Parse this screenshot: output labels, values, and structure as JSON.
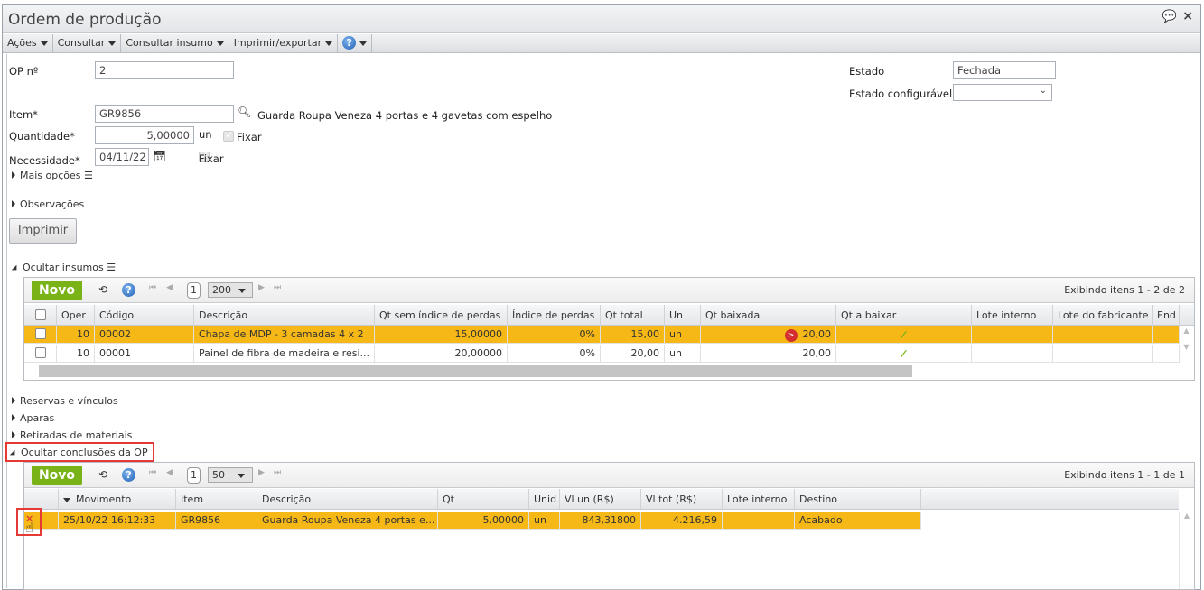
{
  "window": {
    "title": "Ordem de produção"
  },
  "toolbar": {
    "items": [
      "Ações",
      "Consultar",
      "Consultar insumo",
      "Imprimir/exportar"
    ]
  },
  "form": {
    "op_label": "OP nº",
    "op_value": "2",
    "item_label": "Item*",
    "item_value": "GR9856",
    "item_desc": "Guarda Roupa Veneza 4 portas e 4 gavetas com espelho",
    "qty_label": "Quantidade*",
    "qty_value": "5,00000",
    "qty_unit": "un",
    "fixar": "Fixar",
    "need_label": "Necessidade*",
    "need_value": "04/11/22",
    "estado_label": "Estado",
    "estado_value": "Fechada",
    "estado_conf_label": "Estado configurável",
    "estado_conf_value": "",
    "mais_opcoes": "Mais opções",
    "observacoes": "Observações",
    "imprimir": "Imprimir"
  },
  "insumos": {
    "toggle": "Ocultar insumos",
    "novo": "Novo",
    "page": "1",
    "page_size": "200",
    "info": "Exibindo itens 1 - 2 de 2",
    "columns": [
      "",
      "Oper",
      "Código",
      "Descrição",
      "Qt sem índice de perdas",
      "Índice de perdas",
      "Qt total",
      "Un",
      "Qt baixada",
      "Qt a baixar",
      "Lote interno",
      "Lote do fabricante",
      "End"
    ],
    "rows": [
      [
        "",
        "10",
        "00002",
        "Chapa de MDP - 3 camadas 4 x 2",
        "15,00000",
        "0%",
        "15,00",
        "un",
        "20,00",
        "✓",
        "",
        "",
        ""
      ],
      [
        "",
        "10",
        "00001",
        "Painel de fibra de madeira e resi...",
        "20,00000",
        "0%",
        "20,00",
        "un",
        "20,00",
        "✓",
        "",
        "",
        ""
      ]
    ]
  },
  "sections": [
    "Reservas e vínculos",
    "Aparas",
    "Retiradas de materiais"
  ],
  "conclusoes": {
    "toggle": "Ocultar conclusões da OP",
    "novo": "Novo",
    "page": "1",
    "page_size": "50",
    "info": "Exibindo itens 1 - 1 de 1",
    "columns": [
      "",
      "Movimento",
      "Item",
      "Descrição",
      "Qt",
      "Unid",
      "Vl un (R$)",
      "Vl tot (R$)",
      "Lote interno",
      "Destino"
    ],
    "rows": [
      [
        "",
        "25/10/22 16:12:33",
        "GR9856",
        "Guarda Roupa Veneza 4 portas e...",
        "5,00000",
        "un",
        "843,31800",
        "4.216,59",
        "",
        "Acabado"
      ]
    ]
  },
  "colors": {
    "selected_row": "#f5b817",
    "novo": "#7ab317",
    "highlight": "#e53935"
  }
}
